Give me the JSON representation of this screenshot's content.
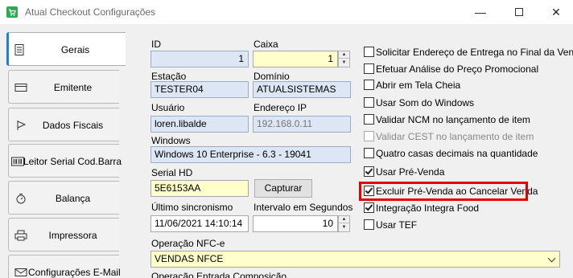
{
  "window": {
    "title": "Atual Checkout Configurações",
    "minimize_glyph": "—",
    "close_glyph": "✕"
  },
  "sidebar": {
    "tabs": [
      {
        "label": "Gerais",
        "icon": "document-icon",
        "active": true
      },
      {
        "label": "Emitente",
        "icon": "card-icon",
        "active": false
      },
      {
        "label": "Dados Fiscais",
        "icon": "flag-icon",
        "active": false
      },
      {
        "label": "Leitor Serial Cod.Barra",
        "icon": "barcode-icon",
        "active": false
      },
      {
        "label": "Balança",
        "icon": "scale-icon",
        "active": false
      },
      {
        "label": "Impressora",
        "icon": "printer-icon",
        "active": false
      },
      {
        "label": "Configurações E-Mail",
        "icon": "email-icon",
        "active": false
      }
    ]
  },
  "form": {
    "id": {
      "label": "ID",
      "value": "1"
    },
    "caixa": {
      "label": "Caixa",
      "value": "1"
    },
    "estacao": {
      "label": "Estação",
      "value": "TESTER04"
    },
    "dominio": {
      "label": "Domínio",
      "value": "ATUALSISTEMAS"
    },
    "usuario": {
      "label": "Usuário",
      "value": "loren.libalde"
    },
    "endereco_ip": {
      "label": "Endereço IP",
      "value": "192.168.0.11"
    },
    "windows": {
      "label": "Windows",
      "value": "Windows 10 Enterprise - 6.3 - 19041"
    },
    "serial_hd": {
      "label": "Serial HD",
      "value": "5E6153AA"
    },
    "capturar_label": "Capturar",
    "ultimo_sincronismo": {
      "label": "Último sincronismo",
      "value": "11/06/2021 14:10:14"
    },
    "intervalo": {
      "label": "Intervalo em Segundos",
      "value": "10"
    },
    "operacao_nfce": {
      "label": "Operação NFC-e",
      "value": "VENDAS NFCE"
    },
    "operacao_entrada_label": "Operação Entrada Composição"
  },
  "options": [
    {
      "label": "Solicitar Endereço de Entrega no Final da Venda",
      "checked": false,
      "disabled": false
    },
    {
      "label": "Efetuar Análise do Preço Promocional",
      "checked": false,
      "disabled": false
    },
    {
      "label": "Abrir em Tela Cheia",
      "checked": false,
      "disabled": false
    },
    {
      "label": "Usar Som do Windows",
      "checked": false,
      "disabled": false
    },
    {
      "label": "Validar NCM no lançamento de item",
      "checked": false,
      "disabled": false
    },
    {
      "label": "Validar CEST no lançamento de item",
      "checked": false,
      "disabled": true
    },
    {
      "label": "Quatro casas decimais na quantidade",
      "checked": false,
      "disabled": false
    },
    {
      "label": "Usar Pré-Venda",
      "checked": true,
      "disabled": false
    },
    {
      "label": "Excluir Pré-Venda ao Cancelar Venda",
      "checked": true,
      "disabled": false
    },
    {
      "label": "Integração Integra Food",
      "checked": true,
      "disabled": false
    },
    {
      "label": "Usar TEF",
      "checked": false,
      "disabled": false
    }
  ],
  "colors": {
    "accent": "#1e7fd8",
    "highlight": "#e50000",
    "readonly_field": "#dce6f4",
    "editable_field": "#ffffcc"
  }
}
